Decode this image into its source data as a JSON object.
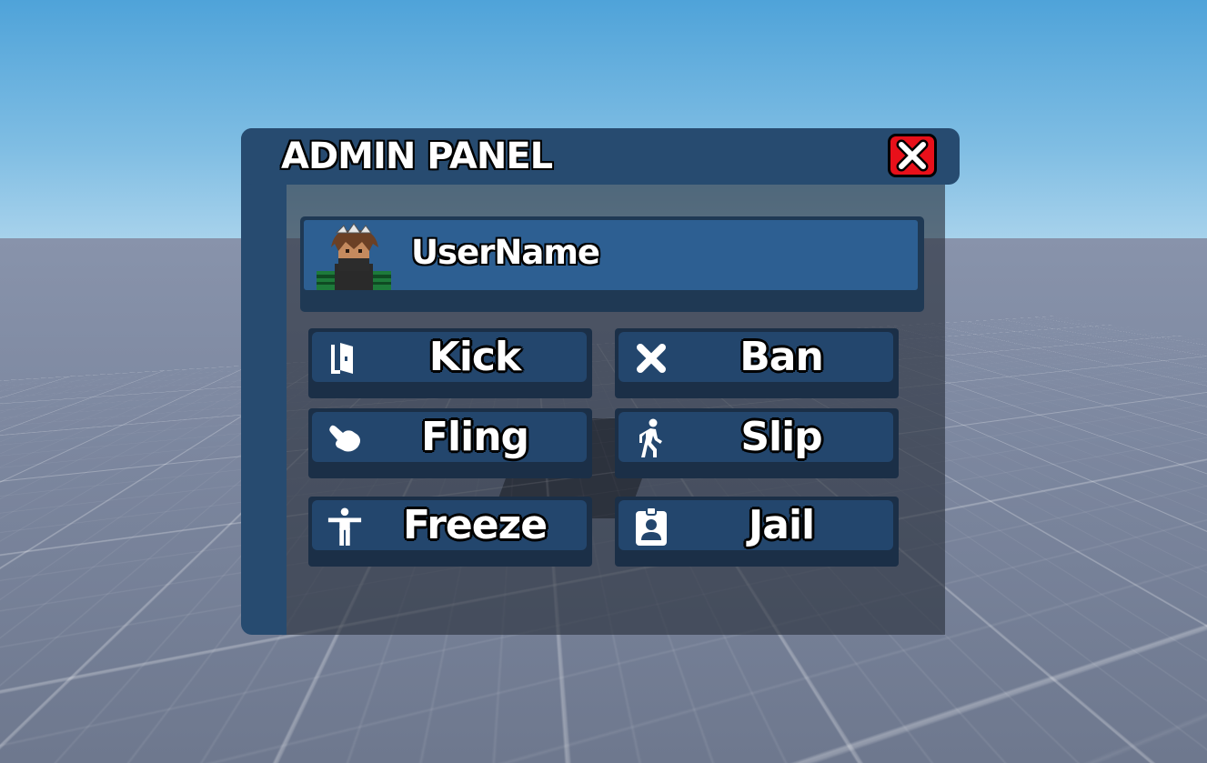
{
  "window": {
    "title": "ADMIN PANEL",
    "close_icon": "close-x-icon",
    "close_color": "#e8101a"
  },
  "user": {
    "name": "UserName",
    "avatar_icon": "player-avatar"
  },
  "actions": [
    {
      "label": "Kick",
      "icon": "door-exit-icon"
    },
    {
      "label": "Ban",
      "icon": "x-mark-icon"
    },
    {
      "label": "Fling",
      "icon": "hand-pointing-icon"
    },
    {
      "label": "Slip",
      "icon": "walking-person-icon"
    },
    {
      "label": "Freeze",
      "icon": "standing-person-icon"
    },
    {
      "label": "Jail",
      "icon": "id-badge-icon"
    }
  ],
  "colors": {
    "panel": "#274b70",
    "user_card": "#2d5f92",
    "button": "#23466d",
    "sky": "#4fa3d9"
  }
}
